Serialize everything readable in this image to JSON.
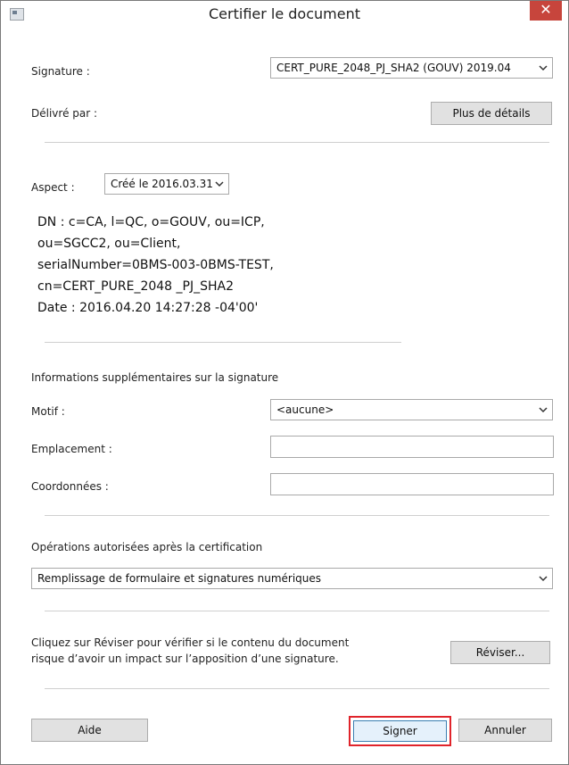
{
  "window": {
    "title": "Certifier le document",
    "close_glyph": "✕"
  },
  "signature": {
    "label": "Signature :",
    "selected": "CERT_PURE_2048_PJ_SHA2 (GOUV) 2019.04"
  },
  "issuer": {
    "label": "Délivré par :",
    "details_button": "Plus de détails"
  },
  "aspect": {
    "label": "Aspect :",
    "selected": "Créé le 2016.03.31"
  },
  "dn_lines": [
    "DN : c=CA, l=QC, o=GOUV, ou=ICP,",
    "ou=SGCC2, ou=Client,",
    "serialNumber=0BMS-003-0BMS-TEST,",
    "cn=CERT_PURE_2048 _PJ_SHA2",
    "Date : 2016.04.20 14:27:28 -04'00'"
  ],
  "additional": {
    "heading": "Informations supplémentaires sur la signature",
    "motif_label": "Motif :",
    "motif_selected": "<aucune>",
    "location_label": "Emplacement :",
    "location_value": "",
    "contact_label": "Coordonnées :",
    "contact_value": ""
  },
  "permissions": {
    "heading": "Opérations autorisées après la certification",
    "selected": "Remplissage de formulaire et signatures numériques"
  },
  "review": {
    "text_line1": "Cliquez sur Réviser pour vérifier si le contenu du document",
    "text_line2": "risque d’avoir un impact sur l’apposition d’une signature.",
    "button": "Réviser..."
  },
  "footer": {
    "help": "Aide",
    "sign": "Signer",
    "cancel": "Annuler"
  },
  "colors": {
    "close": "#c7453c",
    "highlight": "#e0242b",
    "default_button": "#e5f1fb"
  }
}
